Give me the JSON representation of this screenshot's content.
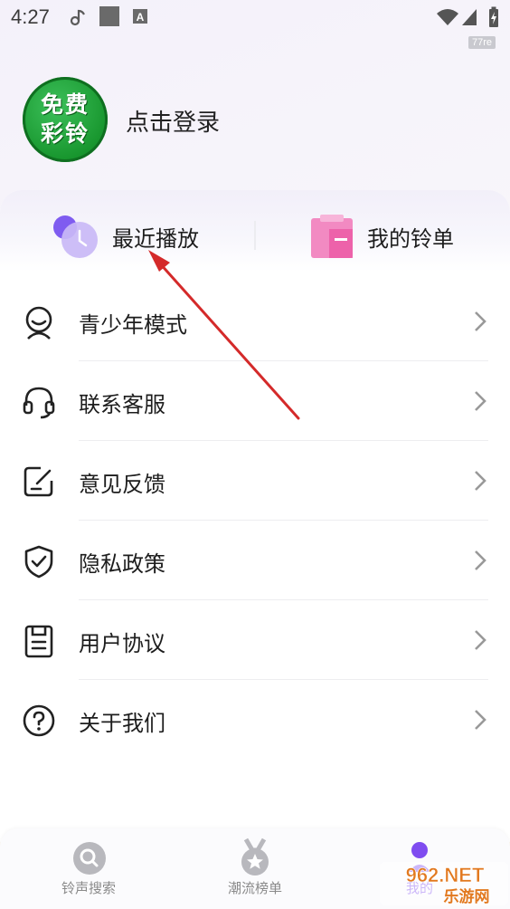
{
  "status_bar": {
    "time": "4:27",
    "badge": "77re"
  },
  "header": {
    "avatar_line1": "免费",
    "avatar_line2": "彩铃",
    "login_label": "点击登录"
  },
  "quick_actions": {
    "recent_label": "最近播放",
    "playlist_label": "我的铃单"
  },
  "menu": [
    {
      "label": "青少年模式",
      "icon": "teen-mode-icon"
    },
    {
      "label": "联系客服",
      "icon": "headset-icon"
    },
    {
      "label": "意见反馈",
      "icon": "feedback-edit-icon"
    },
    {
      "label": "隐私政策",
      "icon": "shield-check-icon"
    },
    {
      "label": "用户协议",
      "icon": "document-icon"
    },
    {
      "label": "关于我们",
      "icon": "question-circle-icon"
    }
  ],
  "bottom_nav": {
    "search_label": "铃声搜索",
    "charts_label": "潮流榜单",
    "mine_label": "我的"
  },
  "watermark": {
    "text_top": "962.NET",
    "text_bottom": "乐游网"
  },
  "colors": {
    "accent_purple": "#8d6cf0",
    "pink": "#ec5aa6",
    "arrow_red": "#d42a2a",
    "avatar_green": "#1f9e34"
  }
}
